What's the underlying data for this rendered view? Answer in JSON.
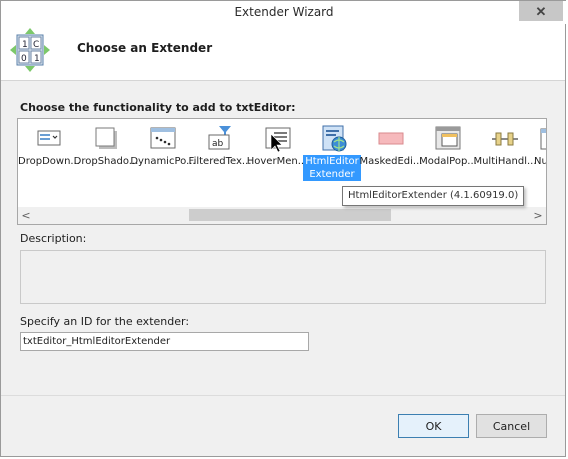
{
  "window": {
    "title": "Extender Wizard",
    "close_glyph": "✕"
  },
  "header": {
    "title": "Choose an Extender",
    "logo_icon": "extender-wizard-icon"
  },
  "functionality": {
    "label": "Choose the functionality to add to txtEditor:"
  },
  "extenders": [
    {
      "label": "DropDown...",
      "icon": "dropdown-icon"
    },
    {
      "label": "DropShado...",
      "icon": "dropshadow-icon"
    },
    {
      "label": "DynamicPo...",
      "icon": "dynamic-populate-icon"
    },
    {
      "label": "FilteredTex...",
      "icon": "filtered-textbox-icon"
    },
    {
      "label": "HoverMen...",
      "icon": "hover-menu-icon"
    },
    {
      "label": "HtmlEditorExtender",
      "icon": "html-editor-icon",
      "selected": true
    },
    {
      "label": "MaskedEdi...",
      "icon": "masked-edit-icon"
    },
    {
      "label": "ModalPop...",
      "icon": "modal-popup-icon"
    },
    {
      "label": "MultiHandl...",
      "icon": "multi-handle-slider-icon"
    },
    {
      "label": "Nur",
      "icon": "numeric-updown-icon"
    }
  ],
  "tooltip": "HtmlEditorExtender (4.1.60919.0)",
  "description": {
    "label": "Description:",
    "text": ""
  },
  "extender_id": {
    "label": "Specify an ID for the extender:",
    "value": "txtEditor_HtmlEditorExtender"
  },
  "buttons": {
    "ok": "OK",
    "cancel": "Cancel"
  },
  "scroll": {
    "left_glyph": "<",
    "right_glyph": ">"
  }
}
